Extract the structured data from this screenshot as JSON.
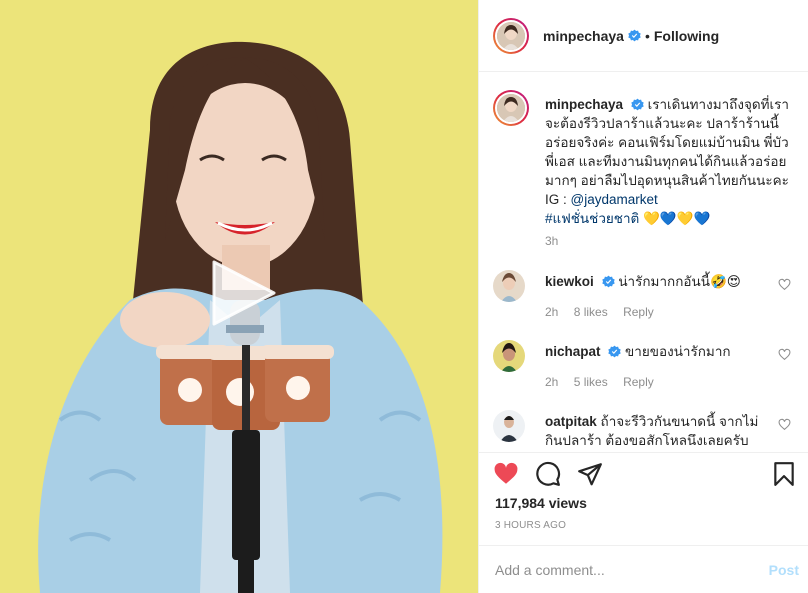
{
  "post": {
    "username": "minpechaya",
    "follow_status": "Following",
    "separator": "•",
    "caption_text": "เราเดินทางมาถึงจุดที่เราจะต้องรีวิวปลาร้าแล้วนะคะ ปลาร้าร้านนี้อร่อยจริงค่ะ คอนเฟิร์มโดยแม่บ้านมิน พี่บัว พี่เอส และทีมงานมินทุกคนได้กินแล้วอร่อยมากๆ อย่าลืมไปอุดหนุนสินค้าไทยกันนะคะ IG : ",
    "caption_link": "@jaydamarket",
    "caption_hashtag": "#แฟชั่นช่วยชาติ",
    "caption_emoji": "💛💙💛💙",
    "caption_time": "3h",
    "views": "117,984 views",
    "posted_ago": "3 HOURS AGO"
  },
  "comments": [
    {
      "username": "kiewkoi",
      "text": "น่ารักมากกอันนี้🤣😍",
      "time": "2h",
      "likes": "8 likes",
      "reply": "Reply"
    },
    {
      "username": "nichapat",
      "text": "ขายของน่ารักมาก",
      "time": "2h",
      "likes": "5 likes",
      "reply": "Reply"
    },
    {
      "username": "oatpitak",
      "text": "ถ้าจะรีวิวกันขนาดนี้ จากไม่กินปลาร้า ต้องขอสักโหลนึงเลยครับ"
    }
  ],
  "composer": {
    "placeholder": "Add a comment...",
    "post_label": "Post"
  },
  "colors": {
    "background_yellow": "#ece47a",
    "coat_blue": "#a9cfe6",
    "like_red": "#ed4956",
    "verified_blue": "#3897f0",
    "link_blue": "#00376b"
  },
  "icons": [
    "play-icon",
    "verified-badge-icon",
    "heart-icon",
    "comment-icon",
    "share-icon",
    "bookmark-icon"
  ]
}
